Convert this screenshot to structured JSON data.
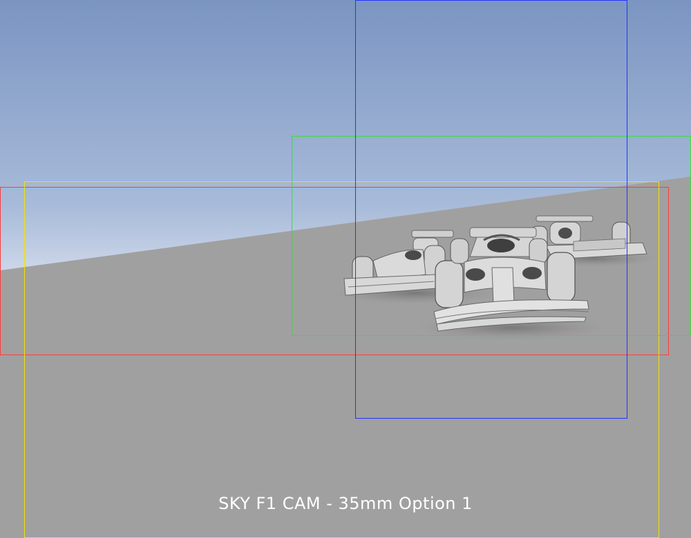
{
  "caption": "SKY F1 CAM - 35mm Option 1",
  "colors": {
    "sky_top": "#7b95c2",
    "sky_horizon": "#c9d4e6",
    "ground": "#a0a0a0",
    "car_body": "#d4d4d4",
    "car_dark": "#5a5a5a",
    "frame_red": "#ff3b3b",
    "frame_yellow": "#f2e200",
    "frame_green": "#35e035",
    "frame_blue": "#2233ff"
  },
  "frames": [
    {
      "id": "red",
      "color_key": "frame_red"
    },
    {
      "id": "yellow",
      "color_key": "frame_yellow"
    },
    {
      "id": "green",
      "color_key": "frame_green"
    },
    {
      "id": "blue",
      "color_key": "frame_blue"
    }
  ],
  "cars": [
    {
      "id": "car-left"
    },
    {
      "id": "car-rear-right"
    },
    {
      "id": "car-front-center"
    }
  ]
}
